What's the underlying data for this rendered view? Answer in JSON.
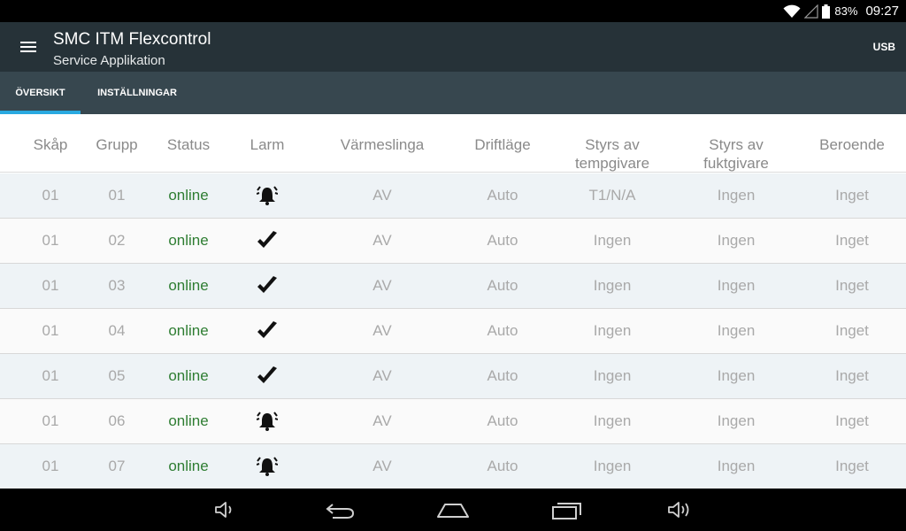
{
  "status_bar": {
    "battery": "83%",
    "time": "09:27"
  },
  "app_bar": {
    "title": "SMC ITM Flexcontrol",
    "subtitle": "Service Applikation",
    "usb_label": "USB"
  },
  "tabs": [
    {
      "label": "ÖVERSIKT",
      "active": true
    },
    {
      "label": "INSTÄLLNINGAR",
      "active": false
    }
  ],
  "table": {
    "headers": [
      "Skåp",
      "Grupp",
      "Status",
      "Larm",
      "Värmeslinga",
      "Driftläge",
      "Styrs av\ntempgivare",
      "Styrs av\nfuktgivare",
      "Beroende"
    ],
    "rows": [
      {
        "skap": "01",
        "grupp": "01",
        "status": "online",
        "larm": "alarm-bell-icon",
        "varmeslinga": "AV",
        "driftlage": "Auto",
        "temp": "T1/N/A",
        "fukt": "Ingen",
        "beroende": "Inget"
      },
      {
        "skap": "01",
        "grupp": "02",
        "status": "online",
        "larm": "checkmark-icon",
        "varmeslinga": "AV",
        "driftlage": "Auto",
        "temp": "Ingen",
        "fukt": "Ingen",
        "beroende": "Inget"
      },
      {
        "skap": "01",
        "grupp": "03",
        "status": "online",
        "larm": "checkmark-icon",
        "varmeslinga": "AV",
        "driftlage": "Auto",
        "temp": "Ingen",
        "fukt": "Ingen",
        "beroende": "Inget"
      },
      {
        "skap": "01",
        "grupp": "04",
        "status": "online",
        "larm": "checkmark-icon",
        "varmeslinga": "AV",
        "driftlage": "Auto",
        "temp": "Ingen",
        "fukt": "Ingen",
        "beroende": "Inget"
      },
      {
        "skap": "01",
        "grupp": "05",
        "status": "online",
        "larm": "checkmark-icon",
        "varmeslinga": "AV",
        "driftlage": "Auto",
        "temp": "Ingen",
        "fukt": "Ingen",
        "beroende": "Inget"
      },
      {
        "skap": "01",
        "grupp": "06",
        "status": "online",
        "larm": "alarm-bell-icon",
        "varmeslinga": "AV",
        "driftlage": "Auto",
        "temp": "Ingen",
        "fukt": "Ingen",
        "beroende": "Inget"
      },
      {
        "skap": "01",
        "grupp": "07",
        "status": "online",
        "larm": "alarm-bell-icon",
        "varmeslinga": "AV",
        "driftlage": "Auto",
        "temp": "Ingen",
        "fukt": "Ingen",
        "beroende": "Inget"
      }
    ]
  },
  "nav_bar": {
    "icons": [
      "volume-down-icon",
      "back-icon",
      "home-icon",
      "recent-apps-icon",
      "volume-up-icon"
    ]
  },
  "colors": {
    "app_bar": "#263238",
    "tab_bar": "#37474f",
    "tab_indicator": "#29a9e0",
    "status_online": "#2e7d32",
    "row_alt": "#eef3f6"
  }
}
